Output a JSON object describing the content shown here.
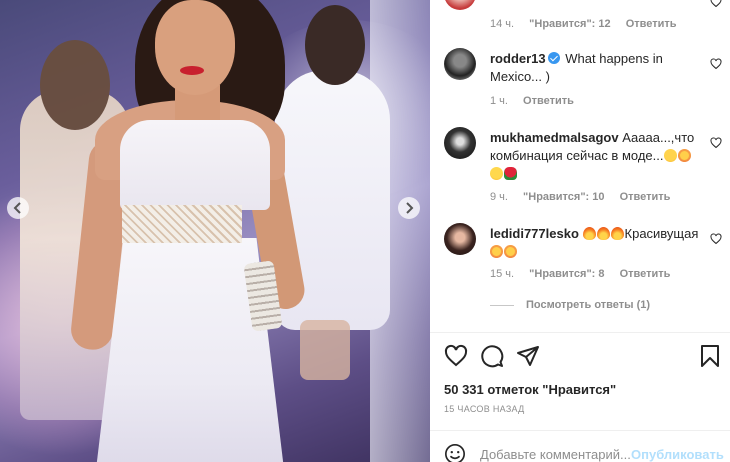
{
  "post": {
    "comments": [
      {
        "username": "",
        "text": "",
        "time": "14 ч.",
        "likes": "\"Нравится\": 12",
        "reply": "Ответить"
      },
      {
        "username": "rodder13",
        "verified": true,
        "text": "What happens in Mexico... )",
        "time": "1 ч.",
        "likes": "",
        "reply": "Ответить"
      },
      {
        "username": "mukhamedmalsagov",
        "text": "Ааааа...,что комбинация сейчас в моде...",
        "emojis_after": [
          "grin",
          "starry",
          "wink",
          "rose"
        ],
        "time": "9 ч.",
        "likes": "\"Нравится\": 10",
        "reply": "Ответить"
      },
      {
        "username": "ledidi777lesko",
        "text": "Красивущая",
        "emojis_before": [
          "fire",
          "fire",
          "fire"
        ],
        "emojis_after": [
          "starry",
          "starry"
        ],
        "time": "15 ч.",
        "likes": "\"Нравится\": 8",
        "reply": "Ответить"
      }
    ],
    "view_replies": "Посмотреть ответы (1)",
    "likes_count": "50 331 отметок \"Нравится\"",
    "posted_ago": "15 ЧАСОВ НАЗАД",
    "add_comment_placeholder": "Добавьте комментарий...",
    "publish_label": "Опубликовать"
  },
  "icons": {
    "like": "heart-icon",
    "comment": "comment-icon",
    "share": "paper-plane-icon",
    "save": "bookmark-icon",
    "emoji": "smiley-icon",
    "prev": "chevron-left-icon",
    "next": "chevron-right-icon"
  },
  "colors": {
    "text": "#262626",
    "muted": "#8e8e8e",
    "verified": "#3897f0",
    "publish_disabled": "#b2dffc"
  }
}
